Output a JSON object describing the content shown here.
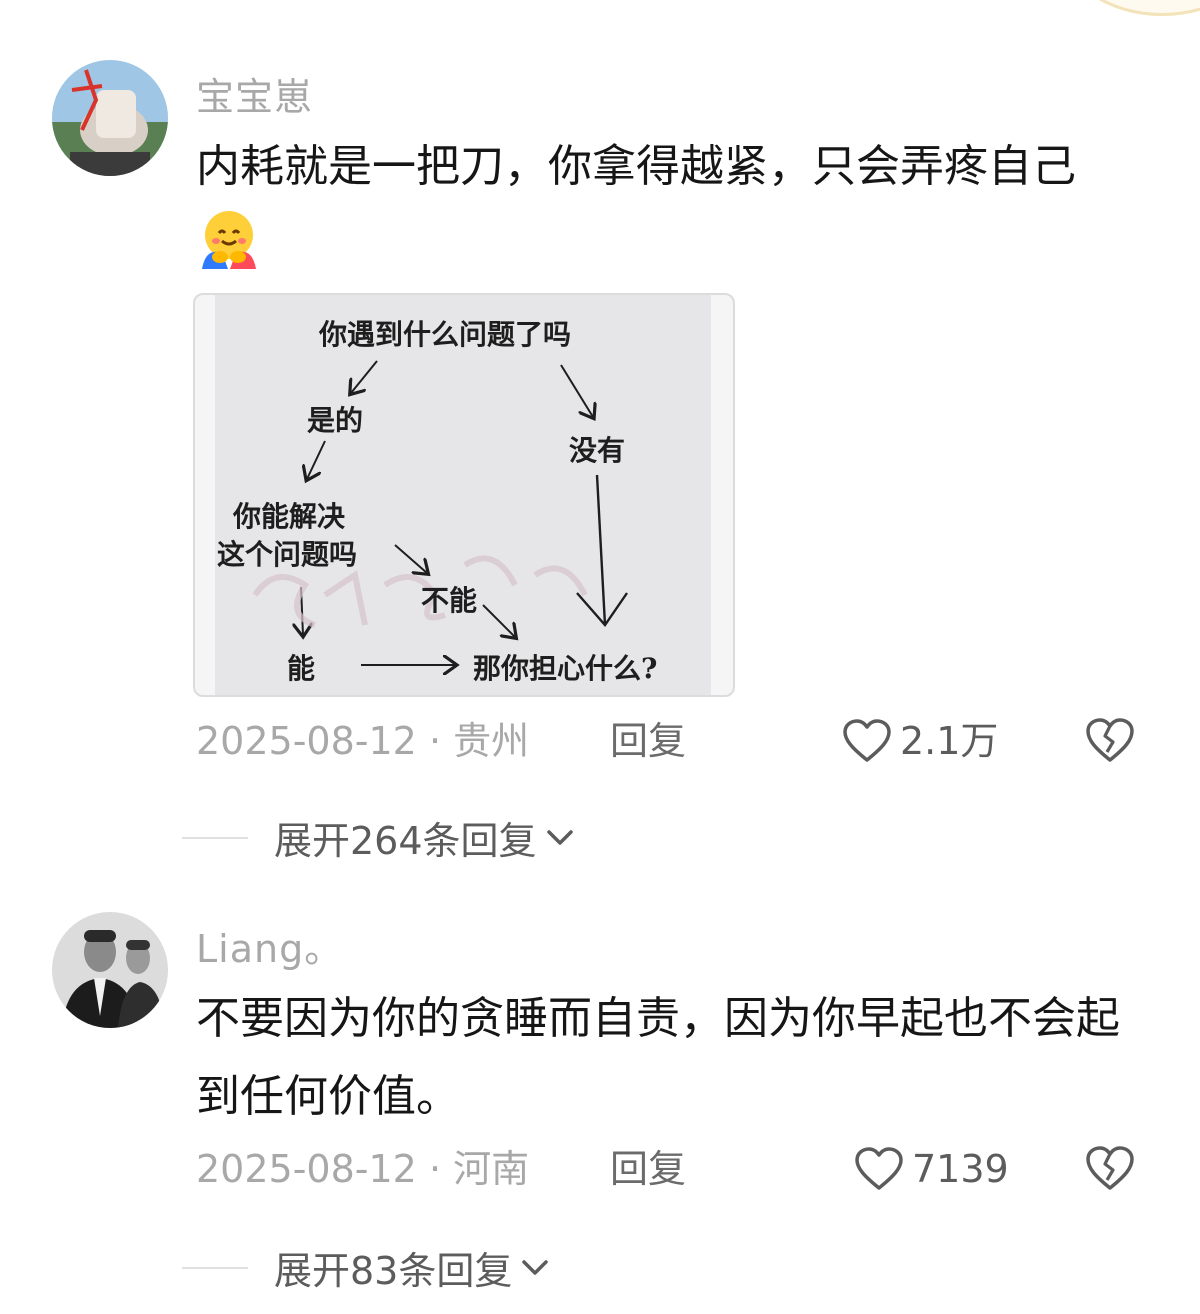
{
  "comments": [
    {
      "username": "宝宝崽",
      "text": "内耗就是一把刀，你拿得越紧，只会弄疼自己",
      "emoji": "hugging-face-emoji",
      "date": "2025-08-12",
      "separator": "·",
      "location": "贵州",
      "reply_label": "回复",
      "likes": "2.1万",
      "expand_label": "展开264条回复",
      "image": {
        "nodes": {
          "q1": "你遇到什么问题了吗",
          "yes": "是的",
          "no": "没有",
          "q2_line1": "你能解决",
          "q2_line2": "这个问题吗",
          "cannot": "不能",
          "can": "能",
          "end": "那你担心什么?"
        }
      }
    },
    {
      "username": "Liang。",
      "text": "不要因为你的贪睡而自责，因为你早起也不会起到任何价值。",
      "date": "2025-08-12",
      "separator": "·",
      "location": "河南",
      "reply_label": "回复",
      "likes": "7139",
      "expand_label": "展开83条回复"
    }
  ],
  "colors": {
    "username": "#a8a8a8",
    "text": "#161616",
    "meta": "#a8a8a8",
    "action": "#5c5c5c"
  },
  "icons": [
    "heart-icon",
    "broken-heart-icon",
    "chevron-down-icon"
  ]
}
